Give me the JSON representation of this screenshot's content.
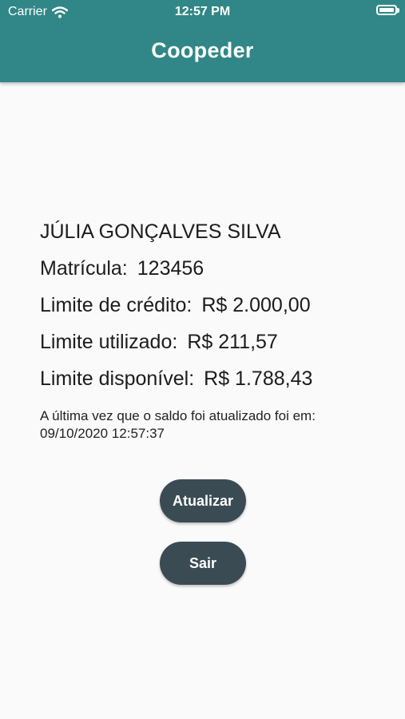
{
  "status_bar": {
    "carrier": "Carrier",
    "time": "12:57 PM"
  },
  "app_bar": {
    "title": "Coopeder"
  },
  "account": {
    "name": "JÚLIA GONÇALVES SILVA",
    "matricula_label": "Matrícula:",
    "matricula_value": "123456",
    "credit_limit_label": "Limite de crédito:",
    "credit_limit_value": "R$ 2.000,00",
    "used_limit_label": "Limite utilizado:",
    "used_limit_value": "R$ 211,57",
    "available_limit_label": "Limite disponível:",
    "available_limit_value": "R$ 1.788,43"
  },
  "last_update": {
    "text": "A última vez que o saldo foi atualizado foi em:",
    "timestamp": "09/10/2020 12:57:37"
  },
  "buttons": {
    "update_label": "Atualizar",
    "exit_label": "Sair"
  },
  "colors": {
    "app_bar": "#318787",
    "button": "#3a4b54",
    "background": "#fafafa"
  },
  "icons": {
    "wifi": "wifi-icon",
    "battery": "battery-icon"
  }
}
